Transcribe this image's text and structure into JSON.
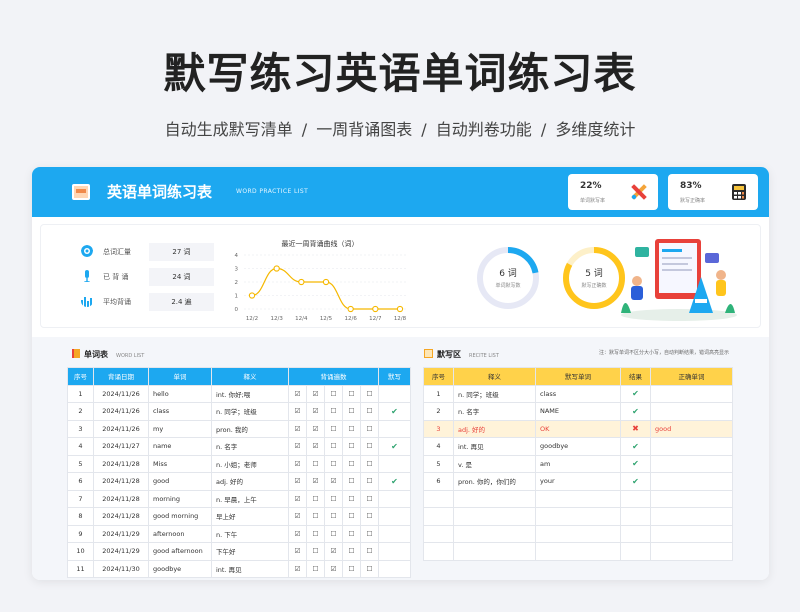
{
  "hero": {
    "title": "默写练习英语单词练习表",
    "subtitle": "自动生成默写清单  /  一周背诵图表  /  自动判卷功能  /  多维度统计"
  },
  "header": {
    "title": "英语单词练习表",
    "subtitle": "WORD PRACTICE LIST",
    "stats": [
      {
        "value": "22%",
        "label": "单词默写率",
        "icon": "cross-shapes-icon"
      },
      {
        "value": "83%",
        "label": "默写正确率",
        "icon": "calculator-icon"
      }
    ]
  },
  "summary": [
    {
      "label": "总词汇量",
      "value": "27 词",
      "icon": "target-icon"
    },
    {
      "label": "已 背 诵",
      "value": "24 词",
      "icon": "microphone-icon"
    },
    {
      "label": "平均背诵",
      "value": "2.4 遍",
      "icon": "equalizer-icon"
    }
  ],
  "chart_data": {
    "type": "line",
    "title": "最近一周背诵曲线（词）",
    "categories": [
      "12/2",
      "12/3",
      "12/4",
      "12/5",
      "12/6",
      "12/7",
      "12/8"
    ],
    "values": [
      1,
      3,
      2,
      2,
      0,
      0,
      0
    ],
    "yticks": [
      "0",
      "1",
      "2",
      "3",
      "4"
    ],
    "ylim": [
      0,
      4
    ],
    "grid": true,
    "color": "#f5b800"
  },
  "rings": [
    {
      "value": "6 词",
      "label": "单词默写数",
      "fraction": 0.22,
      "color": "#1da8f0",
      "track": "#e6e8f5"
    },
    {
      "value": "5 词",
      "label": "默写正确数",
      "fraction": 0.83,
      "color": "#ffc51c",
      "track": "#fdf0c9"
    }
  ],
  "word_list": {
    "title": "单词表",
    "subtitle": "WORD LIST",
    "headers": [
      "序号",
      "背诵日期",
      "单词",
      "释义",
      "背诵遍数",
      "默写"
    ],
    "rows": [
      {
        "no": "1",
        "date": "2024/11/26",
        "word": "hello",
        "meaning": "int. 你好;喂",
        "counts": [
          "☑",
          "☑",
          "☐",
          "☐",
          "☐"
        ],
        "dict": ""
      },
      {
        "no": "2",
        "date": "2024/11/26",
        "word": "class",
        "meaning": "n. 同学；班级",
        "counts": [
          "☑",
          "☑",
          "☐",
          "☐",
          "☐"
        ],
        "dict": "✔"
      },
      {
        "no": "3",
        "date": "2024/11/26",
        "word": "my",
        "meaning": "pron. 我的",
        "counts": [
          "☑",
          "☑",
          "☐",
          "☐",
          "☐"
        ],
        "dict": ""
      },
      {
        "no": "4",
        "date": "2024/11/27",
        "word": "name",
        "meaning": "n. 名字",
        "counts": [
          "☑",
          "☑",
          "☐",
          "☐",
          "☐"
        ],
        "dict": "✔"
      },
      {
        "no": "5",
        "date": "2024/11/28",
        "word": "Miss",
        "meaning": "n. 小姐；老师",
        "counts": [
          "☑",
          "☐",
          "☐",
          "☐",
          "☐"
        ],
        "dict": ""
      },
      {
        "no": "6",
        "date": "2024/11/28",
        "word": "good",
        "meaning": "adj. 好的",
        "counts": [
          "☑",
          "☑",
          "☑",
          "☐",
          "☐"
        ],
        "dict": "✔"
      },
      {
        "no": "7",
        "date": "2024/11/28",
        "word": "morning",
        "meaning": "n. 早晨，上午",
        "counts": [
          "☑",
          "☐",
          "☐",
          "☐",
          "☐"
        ],
        "dict": ""
      },
      {
        "no": "8",
        "date": "2024/11/28",
        "word": "good morning",
        "meaning": "早上好",
        "counts": [
          "☑",
          "☐",
          "☐",
          "☐",
          "☐"
        ],
        "dict": ""
      },
      {
        "no": "9",
        "date": "2024/11/29",
        "word": "afternoon",
        "meaning": "n. 下午",
        "counts": [
          "☑",
          "☐",
          "☐",
          "☐",
          "☐"
        ],
        "dict": ""
      },
      {
        "no": "10",
        "date": "2024/11/29",
        "word": "good afternoon",
        "meaning": "下午好",
        "counts": [
          "☑",
          "☐",
          "☑",
          "☐",
          "☐"
        ],
        "dict": ""
      },
      {
        "no": "11",
        "date": "2024/11/30",
        "word": "goodbye",
        "meaning": "int. 再见",
        "counts": [
          "☑",
          "☐",
          "☑",
          "☐",
          "☐"
        ],
        "dict": ""
      }
    ]
  },
  "recite": {
    "title": "默写区",
    "subtitle": "RECITE LIST",
    "note": "注：默写单词不区分大小写，自动判断结果，错词高亮显示",
    "headers": [
      "序号",
      "释义",
      "默写单词",
      "结果",
      "正确单词"
    ],
    "rows": [
      {
        "no": "1",
        "meaning": "n. 同学；班级",
        "answer": "class",
        "result": "✔",
        "correct": "",
        "error": false
      },
      {
        "no": "2",
        "meaning": "n. 名字",
        "answer": "NAME",
        "result": "✔",
        "correct": "",
        "error": false
      },
      {
        "no": "3",
        "meaning": "adj. 好的",
        "answer": "OK",
        "result": "✖",
        "correct": "good",
        "error": true
      },
      {
        "no": "4",
        "meaning": "int. 再见",
        "answer": "goodbye",
        "result": "✔",
        "correct": "",
        "error": false
      },
      {
        "no": "5",
        "meaning": "v. 是",
        "answer": "am",
        "result": "✔",
        "correct": "",
        "error": false
      },
      {
        "no": "6",
        "meaning": "pron. 你的，你们的",
        "answer": "your",
        "result": "✔",
        "correct": "",
        "error": false
      }
    ],
    "empty_rows": 4
  }
}
